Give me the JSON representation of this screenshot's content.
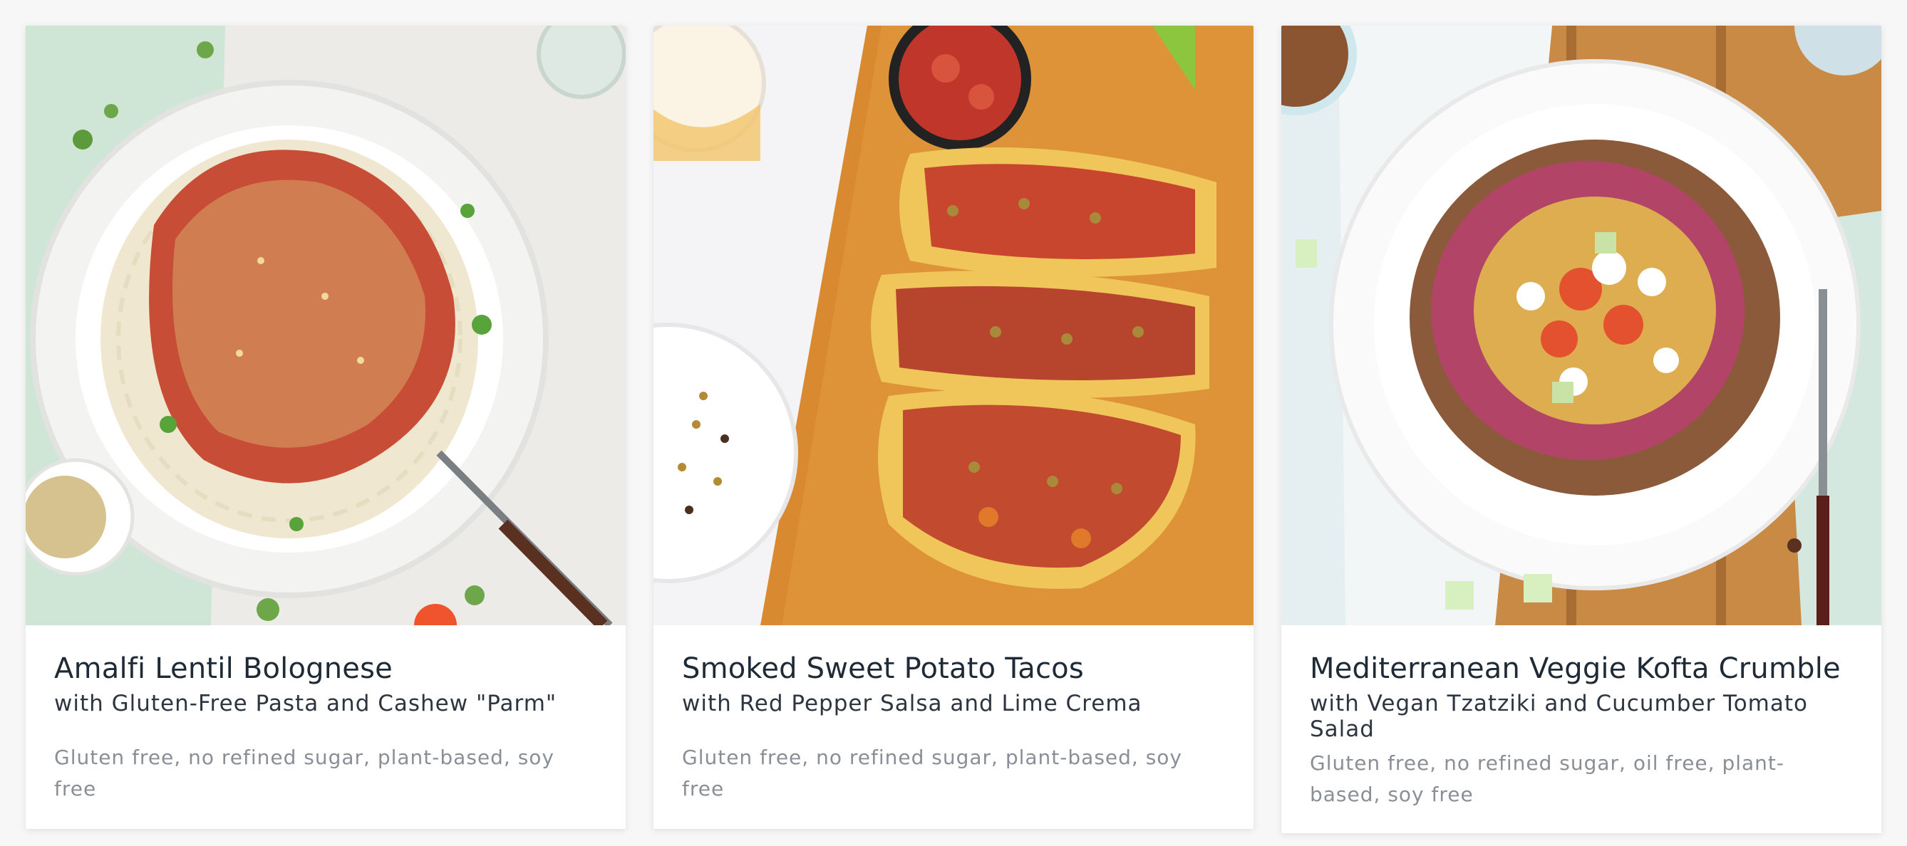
{
  "recipes": [
    {
      "title": "Amalfi Lentil Bolognese",
      "subtitle": "with Gluten-Free Pasta and Cashew \"Parm\"",
      "tags": "Gluten free, no refined sugar, plant-based, soy free",
      "image_icon": "pasta-bowl-photo"
    },
    {
      "title": "Smoked Sweet Potato Tacos",
      "subtitle": "with Red Pepper Salsa and Lime Crema",
      "tags": "Gluten free, no refined sugar, plant-based, soy free",
      "image_icon": "tacos-photo"
    },
    {
      "title": "Mediterranean Veggie Kofta Crumble",
      "subtitle": "with Vegan Tzatziki and Cucumber Tomato Salad",
      "tags": "Gluten free, no refined sugar, oil free, plant-based, soy free",
      "image_icon": "salad-bowl-photo"
    }
  ],
  "colors": {
    "title": "#1f2a37",
    "subtitle": "#2d3540",
    "tags": "#8a8f96",
    "background": "#f7f7f8",
    "card": "#ffffff"
  }
}
